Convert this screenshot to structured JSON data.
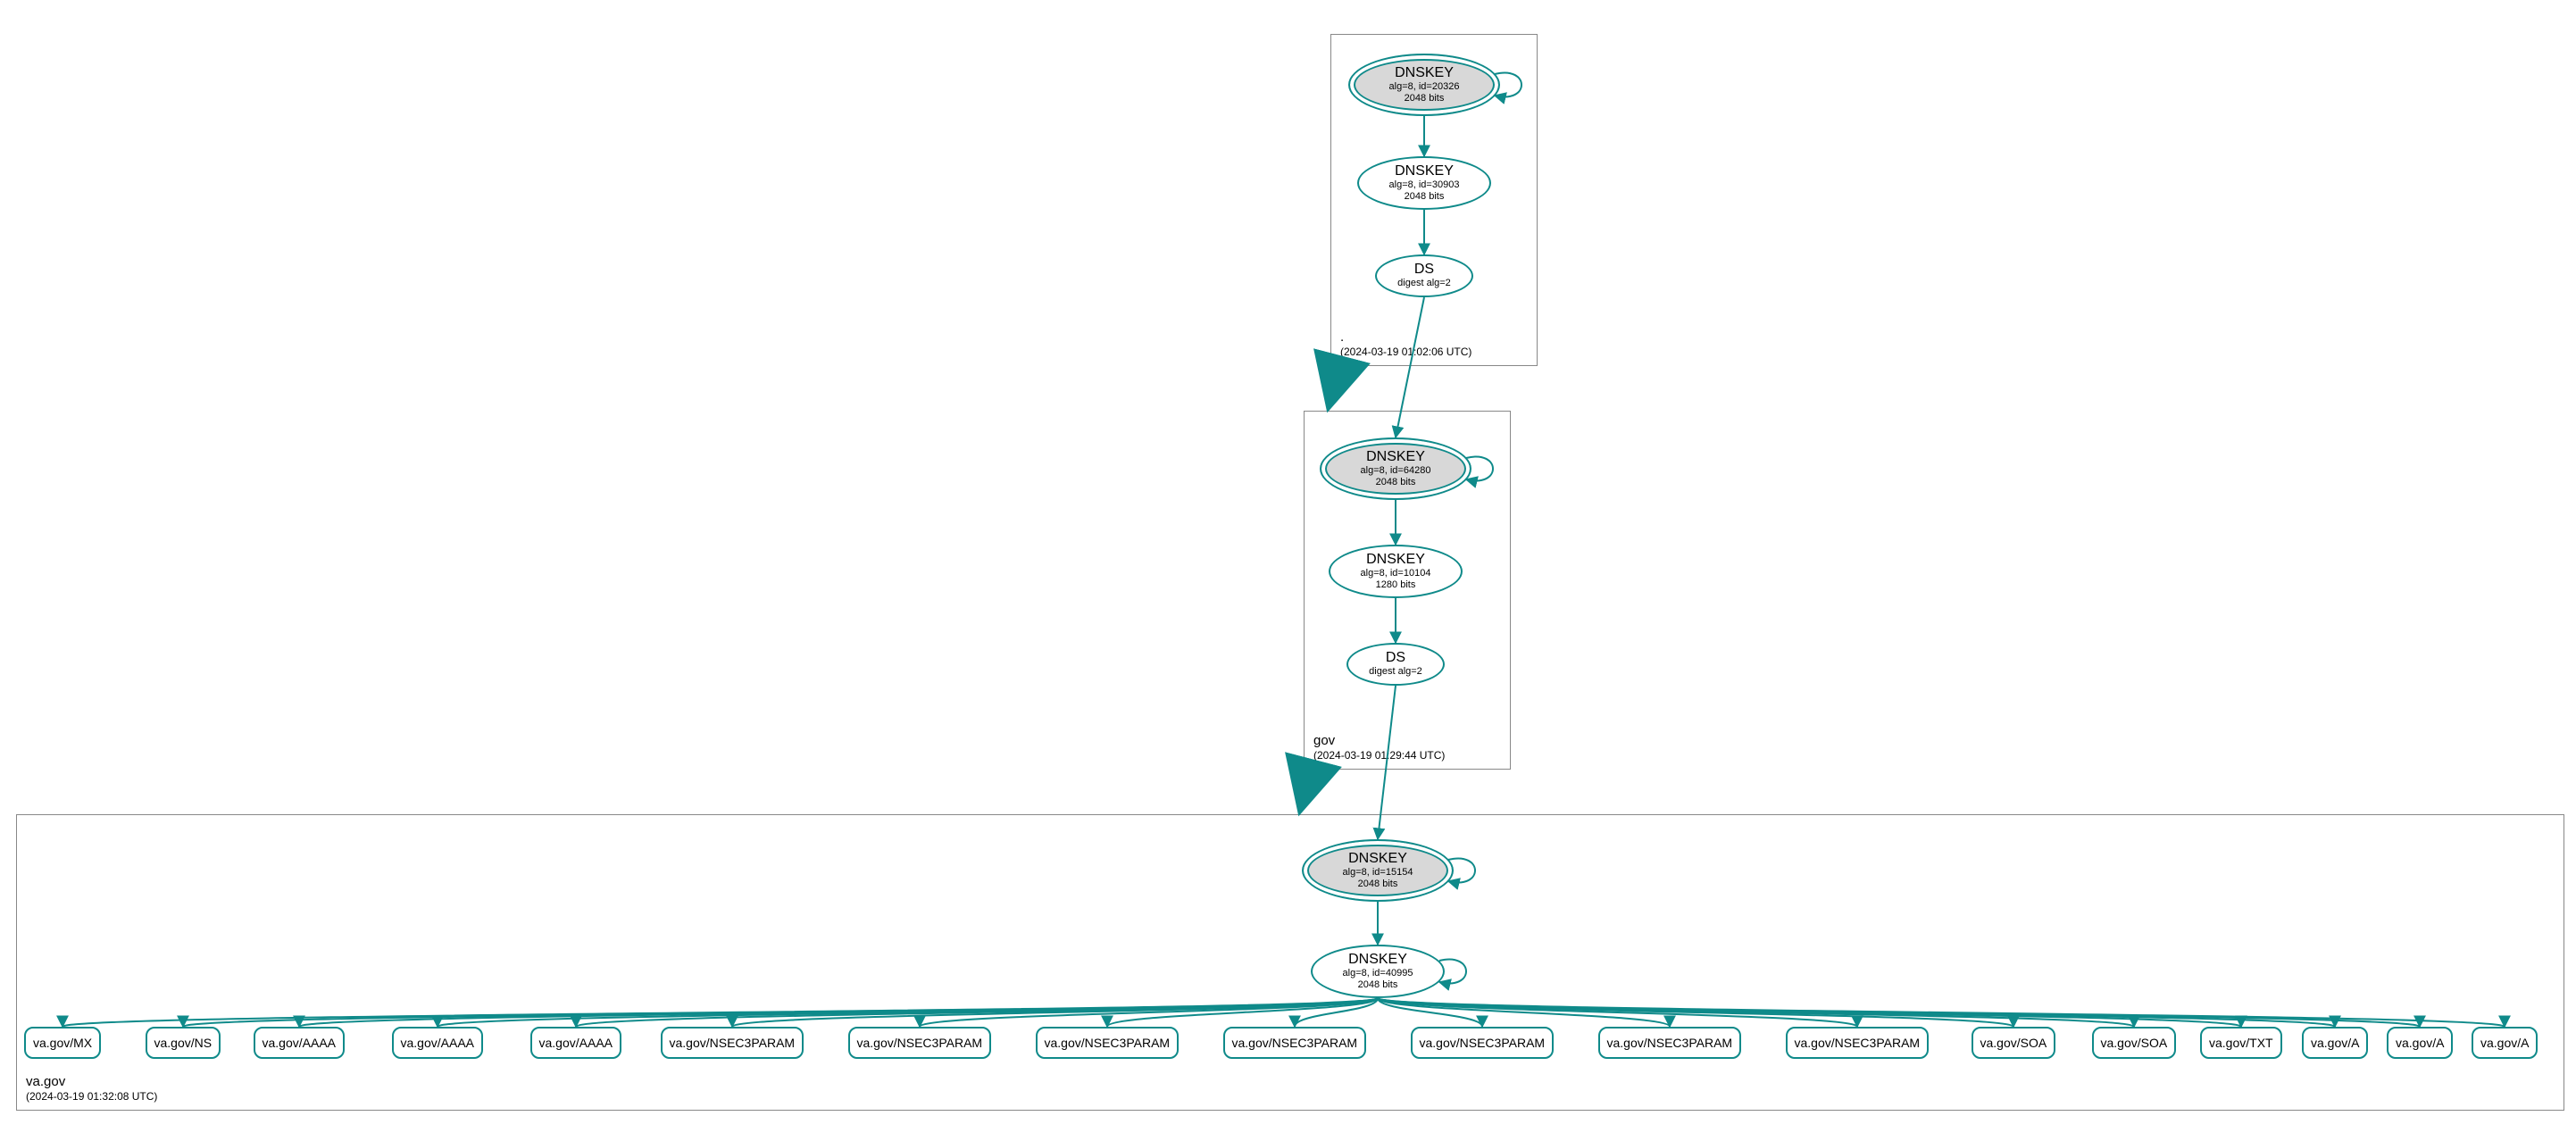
{
  "colors": {
    "edge": "#0f8a8a",
    "node_border": "#0f8a8a",
    "ksk_fill": "#d8d8d8"
  },
  "zones": {
    "root": {
      "name": ".",
      "timestamp": "(2024-03-19 01:02:06 UTC)"
    },
    "gov": {
      "name": "gov",
      "timestamp": "(2024-03-19 01:29:44 UTC)"
    },
    "va": {
      "name": "va.gov",
      "timestamp": "(2024-03-19 01:32:08 UTC)"
    }
  },
  "nodes": {
    "root_ksk": {
      "title": "DNSKEY",
      "sub1": "alg=8, id=20326",
      "sub2": "2048 bits"
    },
    "root_zsk": {
      "title": "DNSKEY",
      "sub1": "alg=8, id=30903",
      "sub2": "2048 bits"
    },
    "root_ds": {
      "title": "DS",
      "sub1": "digest alg=2",
      "sub2": ""
    },
    "gov_ksk": {
      "title": "DNSKEY",
      "sub1": "alg=8, id=64280",
      "sub2": "2048 bits"
    },
    "gov_zsk": {
      "title": "DNSKEY",
      "sub1": "alg=8, id=10104",
      "sub2": "1280 bits"
    },
    "gov_ds": {
      "title": "DS",
      "sub1": "digest alg=2",
      "sub2": ""
    },
    "va_ksk": {
      "title": "DNSKEY",
      "sub1": "alg=8, id=15154",
      "sub2": "2048 bits"
    },
    "va_zsk": {
      "title": "DNSKEY",
      "sub1": "alg=8, id=40995",
      "sub2": "2048 bits"
    }
  },
  "leaves": [
    "va.gov/MX",
    "va.gov/NS",
    "va.gov/AAAA",
    "va.gov/AAAA",
    "va.gov/AAAA",
    "va.gov/NSEC3PARAM",
    "va.gov/NSEC3PARAM",
    "va.gov/NSEC3PARAM",
    "va.gov/NSEC3PARAM",
    "va.gov/NSEC3PARAM",
    "va.gov/NSEC3PARAM",
    "va.gov/NSEC3PARAM",
    "va.gov/SOA",
    "va.gov/SOA",
    "va.gov/TXT",
    "va.gov/A",
    "va.gov/A",
    "va.gov/A"
  ],
  "chart_data": {
    "type": "graph",
    "description": "DNSSEC authentication chain",
    "zones": [
      {
        "name": ".",
        "timestamp": "2024-03-19 01:02:06 UTC",
        "keys": [
          {
            "type": "DNSKEY",
            "role": "KSK",
            "alg": 8,
            "id": 20326,
            "bits": 2048
          },
          {
            "type": "DNSKEY",
            "role": "ZSK",
            "alg": 8,
            "id": 30903,
            "bits": 2048
          }
        ],
        "ds": [
          {
            "digest_alg": 2
          }
        ]
      },
      {
        "name": "gov",
        "timestamp": "2024-03-19 01:29:44 UTC",
        "keys": [
          {
            "type": "DNSKEY",
            "role": "KSK",
            "alg": 8,
            "id": 64280,
            "bits": 2048
          },
          {
            "type": "DNSKEY",
            "role": "ZSK",
            "alg": 8,
            "id": 10104,
            "bits": 1280
          }
        ],
        "ds": [
          {
            "digest_alg": 2
          }
        ]
      },
      {
        "name": "va.gov",
        "timestamp": "2024-03-19 01:32:08 UTC",
        "keys": [
          {
            "type": "DNSKEY",
            "role": "KSK",
            "alg": 8,
            "id": 15154,
            "bits": 2048
          },
          {
            "type": "DNSKEY",
            "role": "ZSK",
            "alg": 8,
            "id": 40995,
            "bits": 2048
          }
        ],
        "rrsets": [
          "va.gov/MX",
          "va.gov/NS",
          "va.gov/AAAA",
          "va.gov/AAAA",
          "va.gov/AAAA",
          "va.gov/NSEC3PARAM",
          "va.gov/NSEC3PARAM",
          "va.gov/NSEC3PARAM",
          "va.gov/NSEC3PARAM",
          "va.gov/NSEC3PARAM",
          "va.gov/NSEC3PARAM",
          "va.gov/NSEC3PARAM",
          "va.gov/SOA",
          "va.gov/SOA",
          "va.gov/TXT",
          "va.gov/A",
          "va.gov/A",
          "va.gov/A"
        ]
      }
    ],
    "edges": [
      {
        "from": "root.KSK",
        "to": "root.KSK",
        "self": true
      },
      {
        "from": "root.KSK",
        "to": "root.ZSK"
      },
      {
        "from": "root.ZSK",
        "to": "root.DS"
      },
      {
        "from": "root.DS",
        "to": "gov.KSK"
      },
      {
        "from": "gov.KSK",
        "to": "gov.KSK",
        "self": true
      },
      {
        "from": "gov.KSK",
        "to": "gov.ZSK"
      },
      {
        "from": "gov.ZSK",
        "to": "gov.DS"
      },
      {
        "from": "gov.DS",
        "to": "va.KSK"
      },
      {
        "from": "va.KSK",
        "to": "va.KSK",
        "self": true
      },
      {
        "from": "va.KSK",
        "to": "va.ZSK"
      },
      {
        "from": "va.ZSK",
        "to": "va.ZSK",
        "self": true
      },
      {
        "from": "va.ZSK",
        "to": "va.gov/MX"
      },
      {
        "from": "va.ZSK",
        "to": "va.gov/NS"
      },
      {
        "from": "va.ZSK",
        "to": "va.gov/AAAA"
      },
      {
        "from": "va.ZSK",
        "to": "va.gov/AAAA"
      },
      {
        "from": "va.ZSK",
        "to": "va.gov/AAAA"
      },
      {
        "from": "va.ZSK",
        "to": "va.gov/NSEC3PARAM"
      },
      {
        "from": "va.ZSK",
        "to": "va.gov/NSEC3PARAM"
      },
      {
        "from": "va.ZSK",
        "to": "va.gov/NSEC3PARAM"
      },
      {
        "from": "va.ZSK",
        "to": "va.gov/NSEC3PARAM"
      },
      {
        "from": "va.ZSK",
        "to": "va.gov/NSEC3PARAM"
      },
      {
        "from": "va.ZSK",
        "to": "va.gov/NSEC3PARAM"
      },
      {
        "from": "va.ZSK",
        "to": "va.gov/NSEC3PARAM"
      },
      {
        "from": "va.ZSK",
        "to": "va.gov/SOA"
      },
      {
        "from": "va.ZSK",
        "to": "va.gov/SOA"
      },
      {
        "from": "va.ZSK",
        "to": "va.gov/TXT"
      },
      {
        "from": "va.ZSK",
        "to": "va.gov/A"
      },
      {
        "from": "va.ZSK",
        "to": "va.gov/A"
      },
      {
        "from": "va.ZSK",
        "to": "va.gov/A"
      }
    ]
  }
}
